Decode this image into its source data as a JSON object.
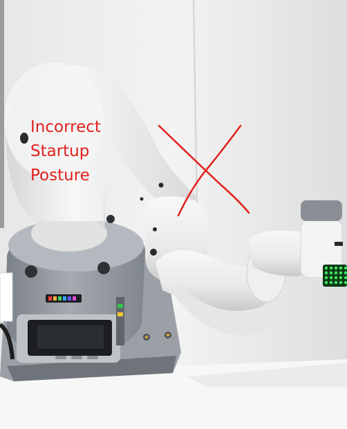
{
  "annotation": {
    "lines": [
      "Incorrect",
      "Startup",
      "Posture"
    ],
    "color": "#e0201c"
  },
  "colors": {
    "arm_white": "#f4f4f4",
    "arm_shadow": "#c9c9c9",
    "base_gray": "#8e949b",
    "base_plate": "#a7acb2",
    "screen": "#1b1d20",
    "end_effector_led": "#26d44a",
    "cross_mark": "#e0201c"
  },
  "icons": [
    "red-cross-mark"
  ]
}
